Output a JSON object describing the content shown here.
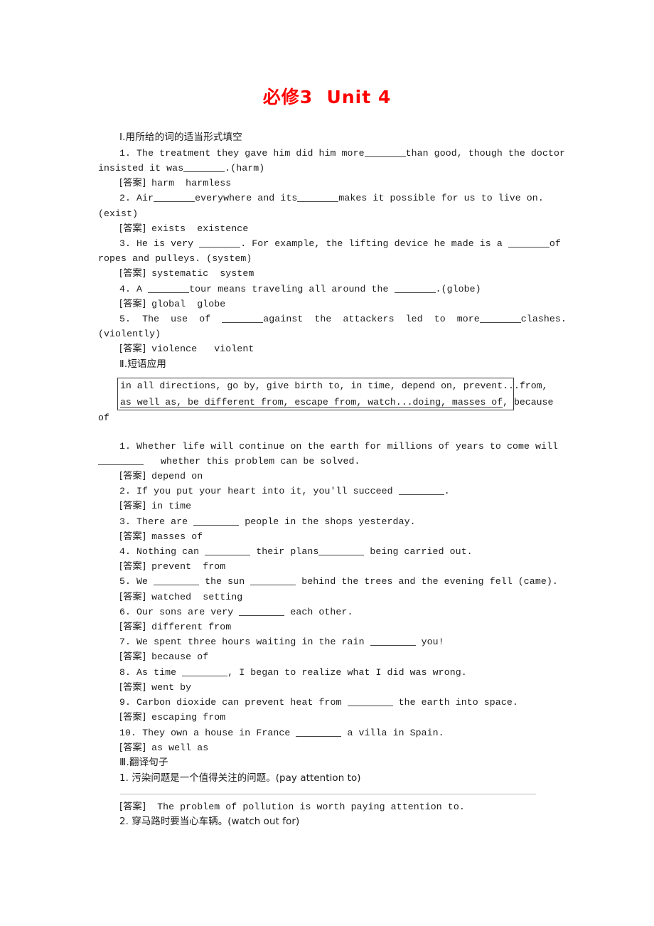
{
  "document": {
    "title": "必修3  Unit 4"
  },
  "section1": {
    "heading": "Ⅰ.用所给的词的适当形式填空",
    "items": [
      {
        "number": "1.",
        "line1_a": "The treatment they gave him did him more",
        "line1_b": "than good, though the doctor",
        "line2_a": "insisted it was",
        "line2_b": ".(harm)",
        "answer_tag": "[答案]",
        "answer_text": "harm  harmless"
      },
      {
        "number": "2.",
        "line1_a": "Air",
        "line1_b": "everywhere and its",
        "line1_c": "makes it possible for us to live on.",
        "line2": "(exist)",
        "answer_tag": "[答案]",
        "answer_text": "exists  existence"
      },
      {
        "number": "3.",
        "line1_a": "He is very",
        "line1_b": ". For example, the lifting device he made is a",
        "line1_c": "of",
        "line2": "ropes and pulleys. (system)",
        "answer_tag": "[答案]",
        "answer_text": "systematic  system"
      },
      {
        "number": "4.",
        "line1_a": "A",
        "line1_b": "tour means traveling all around the",
        "line1_c": ".(globe)",
        "answer_tag": "[答案]",
        "answer_text": "global  globe"
      },
      {
        "number": "5.",
        "line1_a": "The  use  of",
        "line1_b": "against  the  attackers  led  to  more",
        "line1_c": "clashes.",
        "line2": "(violently)",
        "answer_tag": "[答案]",
        "answer_text": "violence   violent"
      }
    ]
  },
  "section2": {
    "heading": "Ⅱ.短语应用",
    "phrase_box": {
      "line1": "in all directions, go by, give birth to, in time, depend on, prevent...from,",
      "line2": "as well as, be different from, escape from, watch...doing, masses of",
      "overflow_line1": "",
      "overflow_line2": ", because",
      "tail": "of"
    },
    "items": [
      {
        "number": "1.",
        "line1": "Whether life will continue on the earth for millions of years to come will",
        "line2": "whether this problem can be solved.",
        "answer_tag": "[答案]",
        "answer_text": "depend on"
      },
      {
        "number": "2.",
        "line1_a": "If you put your heart into it, you'll succeed",
        "line1_b": ".",
        "answer_tag": "[答案]",
        "answer_text": "in time"
      },
      {
        "number": "3.",
        "line1_a": "There are",
        "line1_b": "people in the shops yesterday.",
        "answer_tag": "[答案]",
        "answer_text": "masses of"
      },
      {
        "number": "4.",
        "line1_a": "Nothing can",
        "line1_b": "their plans",
        "line1_c": "being carried out.",
        "answer_tag": "[答案]",
        "answer_text": "prevent  from"
      },
      {
        "number": "5.",
        "line1_a": "We",
        "line1_b": "the sun",
        "line1_c": "behind the trees and the evening fell (came).",
        "answer_tag": "[答案]",
        "answer_text": "watched  setting"
      },
      {
        "number": "6.",
        "line1_a": "Our sons are very",
        "line1_b": "each other.",
        "answer_tag": "[答案]",
        "answer_text": "different from"
      },
      {
        "number": "7.",
        "line1_a": "We spent three hours waiting in the rain",
        "line1_b": "you!",
        "answer_tag": "[答案]",
        "answer_text": "because of"
      },
      {
        "number": "8.",
        "line1_a": "As time",
        "line1_b": ", I began to realize what I did was wrong.",
        "answer_tag": "[答案]",
        "answer_text": "went by"
      },
      {
        "number": "9.",
        "line1_a": "Carbon dioxide can prevent heat from",
        "line1_b": "the earth into space.",
        "answer_tag": "[答案]",
        "answer_text": "escaping from"
      },
      {
        "number": "10.",
        "line1_a": "They own a house in France",
        "line1_b": "a villa in Spain.",
        "answer_tag": "[答案]",
        "answer_text": "as well as"
      }
    ]
  },
  "section3": {
    "heading": "Ⅲ.翻译句子",
    "items": [
      {
        "number": "1.",
        "prompt": "污染问题是一个值得关注的问题。(pay attention to)",
        "answer_tag": "[答案]",
        "answer_text": "The problem of pollution is worth paying attention to."
      },
      {
        "number": "2.",
        "prompt": "穿马路时要当心车辆。(watch out for)",
        "answer_tag": "",
        "answer_text": ""
      }
    ]
  }
}
